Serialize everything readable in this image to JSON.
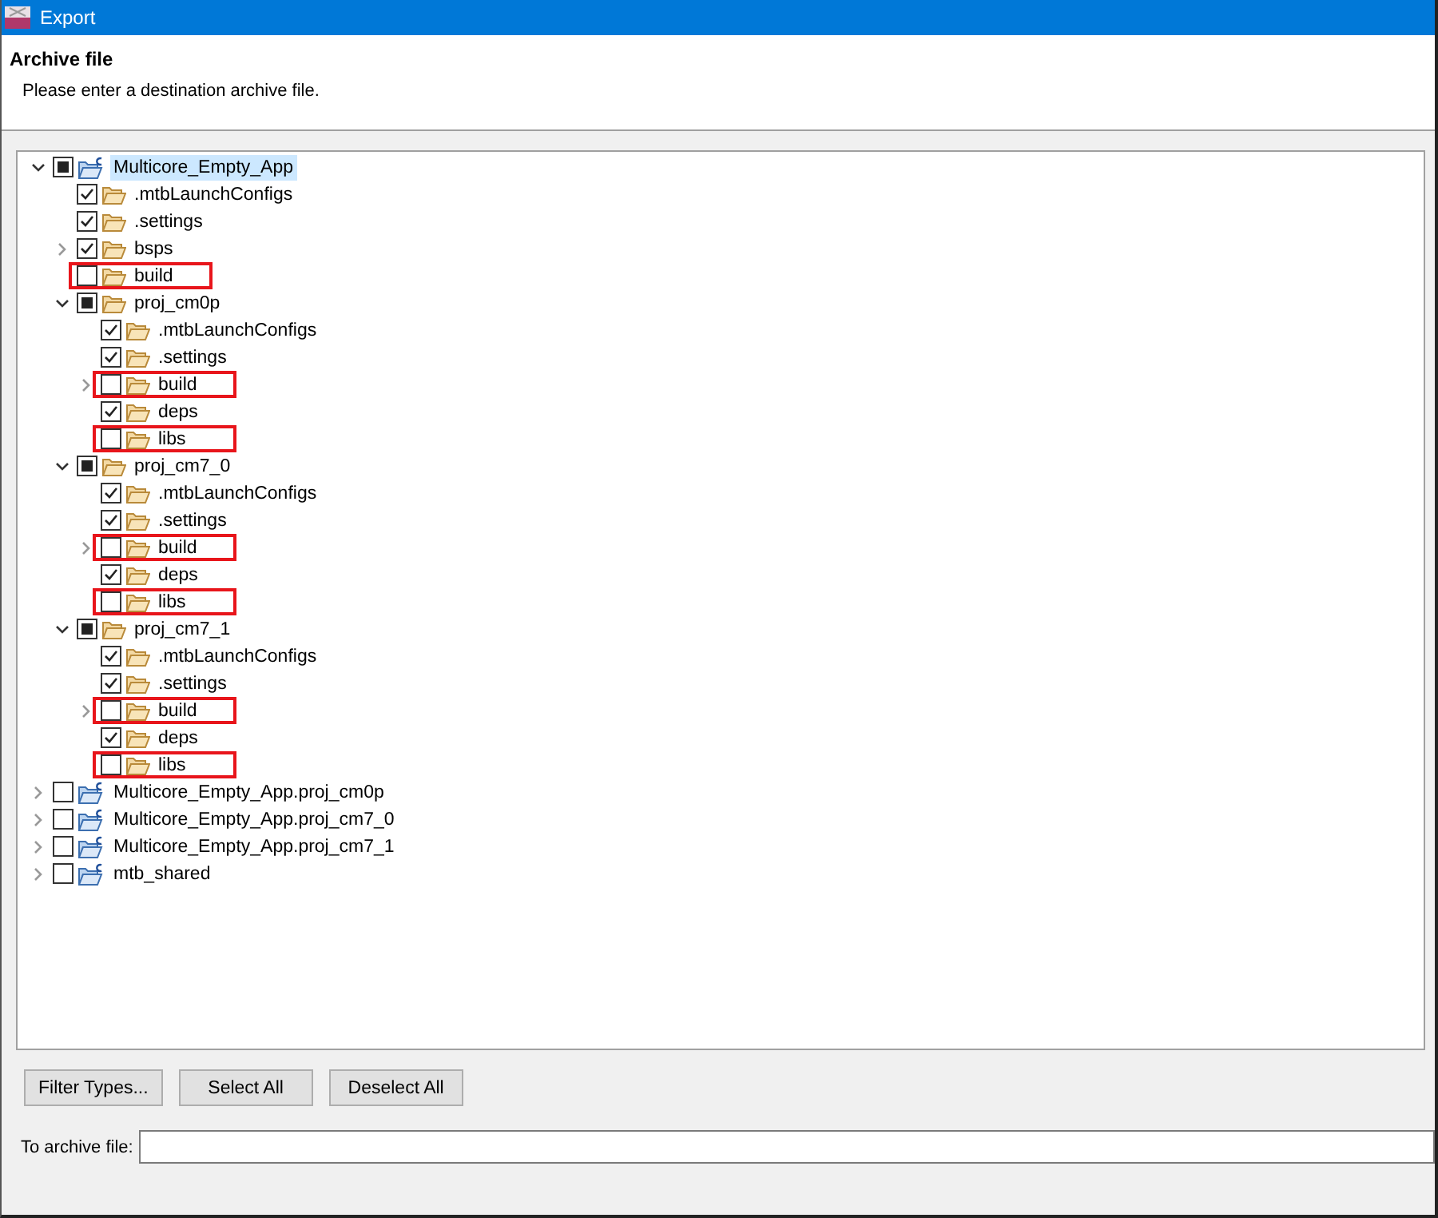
{
  "window": {
    "title": "Export"
  },
  "header": {
    "title": "Archive file",
    "message": "Please enter a destination archive file."
  },
  "tree": [
    {
      "label": "Multicore_Empty_App",
      "kind": "project",
      "checked": false,
      "partial": true,
      "selected": true,
      "highlighted": false,
      "expanded": true,
      "children": [
        {
          "label": ".mtbLaunchConfigs",
          "kind": "folder",
          "checked": true,
          "partial": false,
          "selected": false,
          "highlighted": false
        },
        {
          "label": ".settings",
          "kind": "folder",
          "checked": true,
          "partial": false,
          "selected": false,
          "highlighted": false
        },
        {
          "label": "bsps",
          "kind": "folder",
          "checked": true,
          "partial": false,
          "selected": false,
          "highlighted": false,
          "expanded": false
        },
        {
          "label": "build",
          "kind": "folder",
          "checked": false,
          "partial": false,
          "selected": false,
          "highlighted": true
        },
        {
          "label": "proj_cm0p",
          "kind": "folder",
          "checked": false,
          "partial": true,
          "selected": false,
          "highlighted": false,
          "expanded": true,
          "children": [
            {
              "label": ".mtbLaunchConfigs",
              "kind": "folder",
              "checked": true,
              "partial": false,
              "selected": false,
              "highlighted": false
            },
            {
              "label": ".settings",
              "kind": "folder",
              "checked": true,
              "partial": false,
              "selected": false,
              "highlighted": false
            },
            {
              "label": "build",
              "kind": "folder",
              "checked": false,
              "partial": false,
              "selected": false,
              "highlighted": true,
              "expanded": false
            },
            {
              "label": "deps",
              "kind": "folder",
              "checked": true,
              "partial": false,
              "selected": false,
              "highlighted": false
            },
            {
              "label": "libs",
              "kind": "folder",
              "checked": false,
              "partial": false,
              "selected": false,
              "highlighted": true
            }
          ]
        },
        {
          "label": "proj_cm7_0",
          "kind": "folder",
          "checked": false,
          "partial": true,
          "selected": false,
          "highlighted": false,
          "expanded": true,
          "children": [
            {
              "label": ".mtbLaunchConfigs",
              "kind": "folder",
              "checked": true,
              "partial": false,
              "selected": false,
              "highlighted": false
            },
            {
              "label": ".settings",
              "kind": "folder",
              "checked": true,
              "partial": false,
              "selected": false,
              "highlighted": false
            },
            {
              "label": "build",
              "kind": "folder",
              "checked": false,
              "partial": false,
              "selected": false,
              "highlighted": true,
              "expanded": false
            },
            {
              "label": "deps",
              "kind": "folder",
              "checked": true,
              "partial": false,
              "selected": false,
              "highlighted": false
            },
            {
              "label": "libs",
              "kind": "folder",
              "checked": false,
              "partial": false,
              "selected": false,
              "highlighted": true
            }
          ]
        },
        {
          "label": "proj_cm7_1",
          "kind": "folder",
          "checked": false,
          "partial": true,
          "selected": false,
          "highlighted": false,
          "expanded": true,
          "children": [
            {
              "label": ".mtbLaunchConfigs",
              "kind": "folder",
              "checked": true,
              "partial": false,
              "selected": false,
              "highlighted": false
            },
            {
              "label": ".settings",
              "kind": "folder",
              "checked": true,
              "partial": false,
              "selected": false,
              "highlighted": false
            },
            {
              "label": "build",
              "kind": "folder",
              "checked": false,
              "partial": false,
              "selected": false,
              "highlighted": true,
              "expanded": false
            },
            {
              "label": "deps",
              "kind": "folder",
              "checked": true,
              "partial": false,
              "selected": false,
              "highlighted": false
            },
            {
              "label": "libs",
              "kind": "folder",
              "checked": false,
              "partial": false,
              "selected": false,
              "highlighted": true
            }
          ]
        }
      ]
    },
    {
      "label": "Multicore_Empty_App.proj_cm0p",
      "kind": "project",
      "checked": false,
      "partial": false,
      "selected": false,
      "highlighted": false,
      "expanded": false
    },
    {
      "label": "Multicore_Empty_App.proj_cm7_0",
      "kind": "project",
      "checked": false,
      "partial": false,
      "selected": false,
      "highlighted": false,
      "expanded": false
    },
    {
      "label": "Multicore_Empty_App.proj_cm7_1",
      "kind": "project",
      "checked": false,
      "partial": false,
      "selected": false,
      "highlighted": false,
      "expanded": false
    },
    {
      "label": "mtb_shared",
      "kind": "project",
      "checked": false,
      "partial": false,
      "selected": false,
      "highlighted": false,
      "expanded": false
    }
  ],
  "buttons": [
    "Filter Types...",
    "Select All",
    "Deselect All"
  ],
  "archive_field": {
    "label": "To archive file:"
  }
}
